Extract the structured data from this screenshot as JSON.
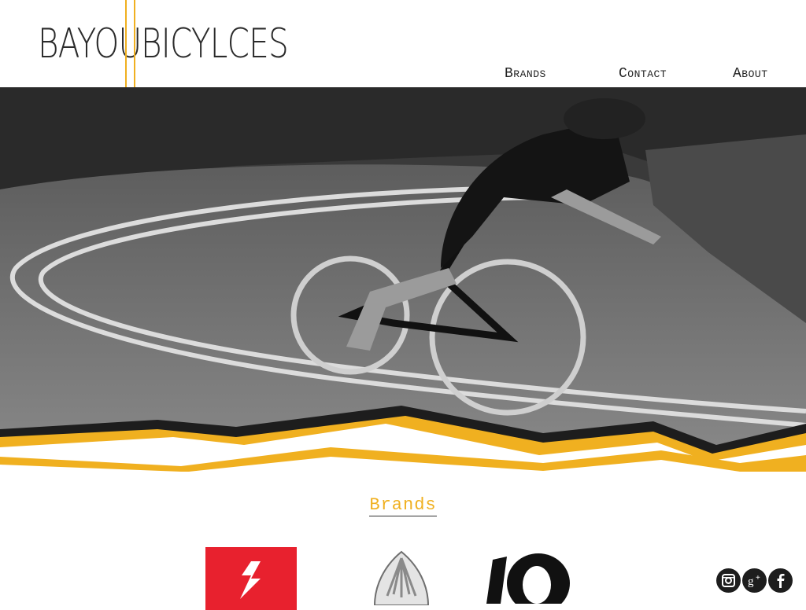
{
  "logo": {
    "word1": "BAYOU",
    "word2": "BICYLCES"
  },
  "nav": {
    "brands": "Brands",
    "contact": "Contact",
    "about": "About"
  },
  "brands_section": {
    "title": "Brands"
  },
  "brand_logos": [
    "specialized-logo",
    "wing-logo",
    "io-logo"
  ],
  "social": [
    "instagram-icon",
    "google-plus-icon",
    "facebook-icon"
  ],
  "colors": {
    "accent": "#f0b020",
    "dark": "#1d1d1d",
    "brand_red": "#e8212e"
  }
}
